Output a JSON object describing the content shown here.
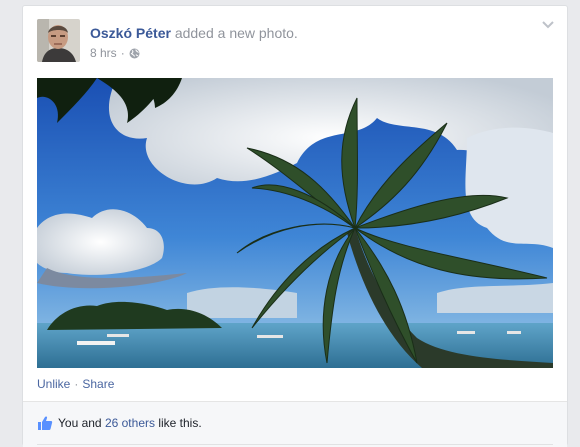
{
  "post": {
    "author": "Oszkó Péter",
    "action_text": " added a new photo.",
    "timestamp": "8 hrs",
    "separator": "·",
    "privacy_icon": "globe-icon",
    "menu_icon": "chevron-down-icon",
    "photo_description": "tropical-beach-palm-tree-photo"
  },
  "actions": {
    "unlike_label": "Unlike",
    "separator": "·",
    "share_label": "Share"
  },
  "likes": {
    "icon": "thumbs-up-icon",
    "prefix": "You and ",
    "others_link": "26 others",
    "suffix": " like this."
  },
  "colors": {
    "link": "#3b5998",
    "muted": "#90949c",
    "background": "#e9eaed"
  }
}
